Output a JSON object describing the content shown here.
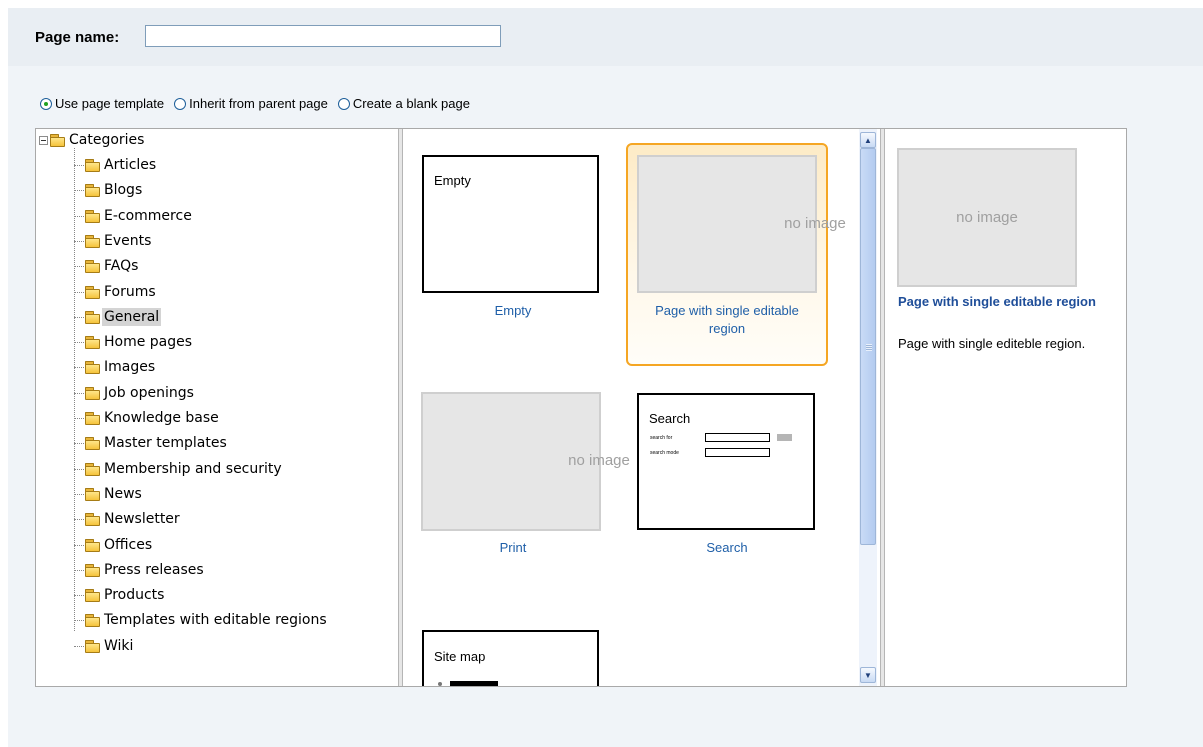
{
  "page_name": {
    "label": "Page name:",
    "value": ""
  },
  "creation_mode": {
    "options": [
      {
        "label": "Use page template",
        "checked": true
      },
      {
        "label": "Inherit from parent page",
        "checked": false
      },
      {
        "label": "Create a blank page",
        "checked": false
      }
    ]
  },
  "tree": {
    "root": "Categories",
    "selected": "General",
    "items": [
      "Articles",
      "Blogs",
      "E-commerce",
      "Events",
      "FAQs",
      "Forums",
      "General",
      "Home pages",
      "Images",
      "Job openings",
      "Knowledge base",
      "Master templates",
      "Membership and security",
      "News",
      "Newsletter",
      "Offices",
      "Press releases",
      "Products",
      "Templates with editable regions",
      "Wiki"
    ]
  },
  "templates": {
    "no_image_text": "no image",
    "empty": {
      "thumb_title": "Empty",
      "label": "Empty"
    },
    "single_region": {
      "label": "Page with single editable region"
    },
    "print": {
      "label": "Print"
    },
    "search": {
      "thumb_title": "Search",
      "search_for": "search for",
      "search_mode": "search mode",
      "label": "Search"
    },
    "site_map": {
      "thumb_title": "Site map"
    }
  },
  "preview": {
    "no_image_text": "no image",
    "title": "Page with single editable region",
    "description": "Page with single editeble region."
  },
  "colors": {
    "link": "#1f5fa8",
    "selection_border": "#f5a623",
    "header_bg": "#e9eef3"
  }
}
